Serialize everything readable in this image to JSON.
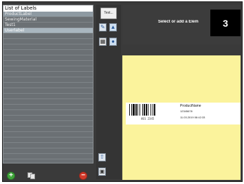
{
  "labels_list": {
    "header": "List of Labels",
    "items": [
      {
        "label": "ProductLabel",
        "state": "selected"
      },
      {
        "label": "SewingMaterial",
        "state": "normal"
      },
      {
        "label": "Test1",
        "state": "normal"
      },
      {
        "label": "Userlabel",
        "state": "highlight"
      }
    ]
  },
  "list_actions": {
    "add_icon": "plus-circle-icon",
    "copy_icon": "copy-icon",
    "remove_icon": "minus-circle-icon"
  },
  "toolbar": {
    "text_button_label": "Text..."
  },
  "header": {
    "prompt": "Select or add a Elem",
    "step_number": "3"
  },
  "label_preview": {
    "barcode_number": "401 2345",
    "product_name": "ProductName",
    "product_code": "12345678",
    "date_line": "11.03.2019  08:42:33"
  },
  "colors": {
    "canvas": "#fbf39c",
    "dark_bg": "#3a3a3a"
  }
}
